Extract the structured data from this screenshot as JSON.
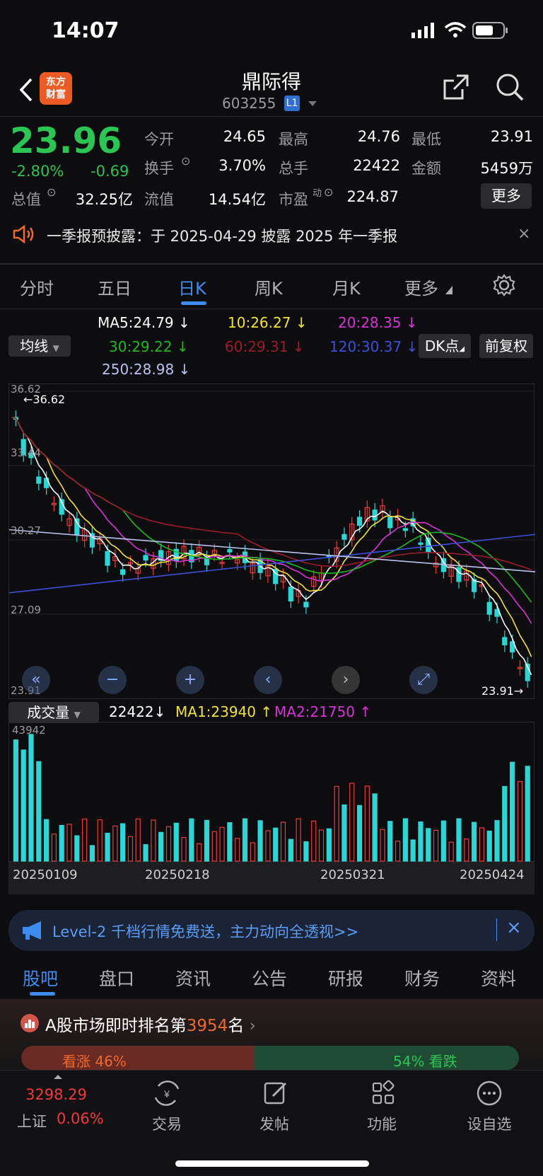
{
  "status": {
    "time": "14:07"
  },
  "nav": {
    "logo": "东方财富",
    "title": "鼎际得",
    "code": "603255",
    "level": "L1"
  },
  "quote": {
    "price": "23.96",
    "change_pct": "-2.80%",
    "change": "-0.69",
    "stats": [
      {
        "label": "今开",
        "value": "24.65"
      },
      {
        "label": "最高",
        "value": "24.76"
      },
      {
        "label": "最低",
        "value": "23.91"
      },
      {
        "label": "换手",
        "value": "3.70%"
      },
      {
        "label": "总手",
        "value": "22422"
      },
      {
        "label": "金额",
        "value": "5459万"
      },
      {
        "label": "总值",
        "value": "32.25亿"
      },
      {
        "label": "流值",
        "value": "14.54亿"
      },
      {
        "label": "市盈",
        "value": "224.87"
      }
    ],
    "pe_sup": "动",
    "more": "更多"
  },
  "notice": {
    "text": "一季报预披露：于 2025-04-29 披露 2025 年一季报"
  },
  "chart_tabs": [
    "分时",
    "五日",
    "日K",
    "周K",
    "月K",
    "更多"
  ],
  "chart_tabs_active": "日K",
  "ma": {
    "selector": "均线",
    "ma5": "MA5:24.79",
    "ma10": "10:26.27",
    "ma20": "20:28.35",
    "ma30": "30:29.22",
    "ma60": "60:29.31",
    "ma120": "120:30.37",
    "ma250": "250:28.98",
    "arrow": "↓",
    "dk": "DK点",
    "adjust": "前复权",
    "colors": {
      "ma5": "#ffffff",
      "ma10": "#f2e233",
      "ma20": "#d832d8",
      "ma30": "#1fb81f",
      "ma60": "#9b1b2e",
      "ma120": "#3b4fd9",
      "ma250": "#b9c2f0"
    }
  },
  "chart_data": {
    "type": "candlestick",
    "y_ticks": [
      "36.62",
      "33.44",
      "30.27",
      "27.09",
      "23.91"
    ],
    "high_label": "←36.62",
    "low_label": "23.91→",
    "ylim": [
      23.91,
      36.62
    ]
  },
  "volume": {
    "selector": "成交量",
    "current": "22422",
    "current_arrow": "↓",
    "ma1": "MA1:23940",
    "ma1_arrow": "↑",
    "ma2": "MA2:21750",
    "ma2_arrow": "↑",
    "max_label": "43942",
    "dates": [
      "20250109",
      "20250218",
      "20250321",
      "20250424"
    ]
  },
  "banner": {
    "text": "Level-2 千档行情免费送，主力动向全透视>>"
  },
  "info_tabs": [
    "股吧",
    "盘口",
    "资讯",
    "公告",
    "研报",
    "财务",
    "资料"
  ],
  "info_tabs_active": "股吧",
  "rank": {
    "prefix": "A股市场即时排名第",
    "number": "3954",
    "suffix": "名",
    "up": "看涨 46%",
    "down": "54% 看跌"
  },
  "bottom": {
    "index_value": "3298.29",
    "index_name": "上证",
    "index_pct": "0.06%",
    "items": [
      "交易",
      "发帖",
      "功能",
      "设自选"
    ]
  }
}
